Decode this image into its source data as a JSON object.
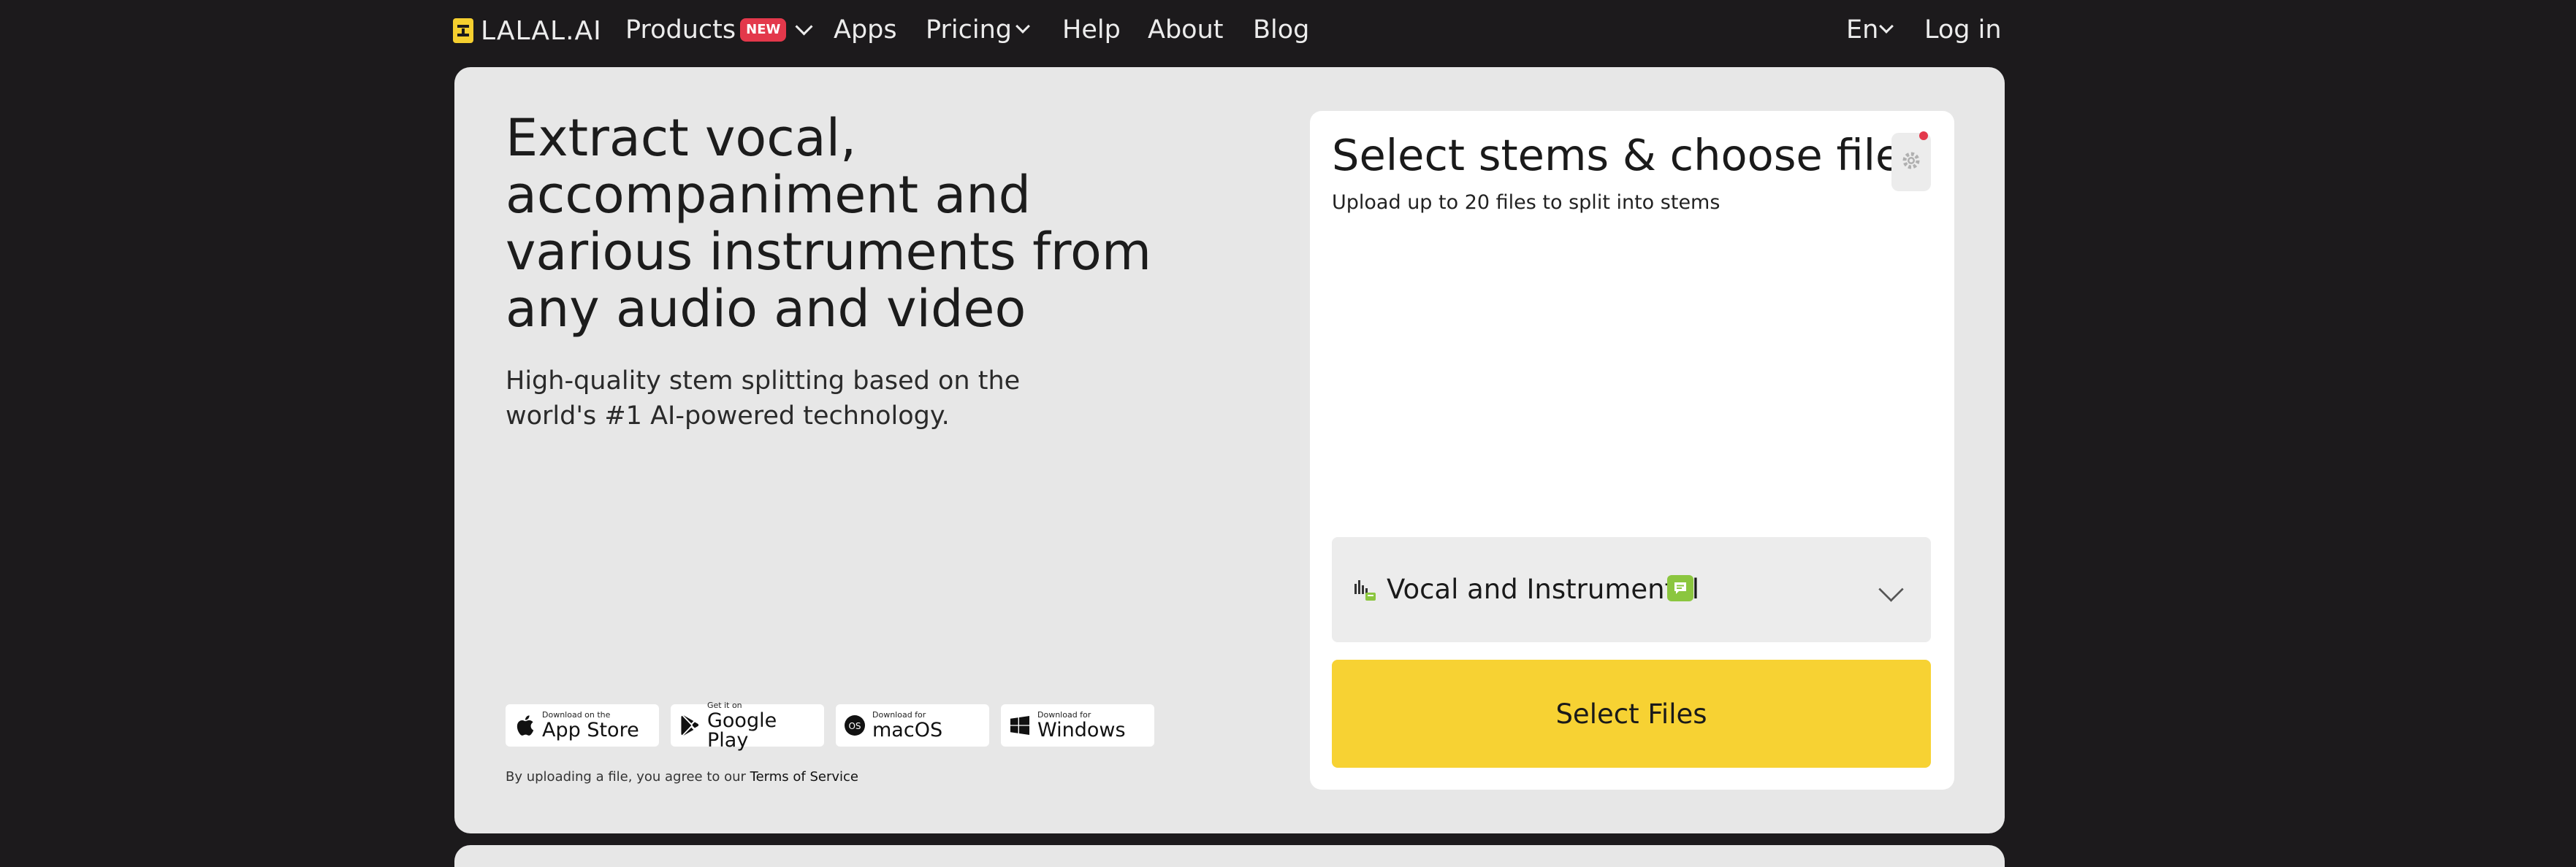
{
  "logo": {
    "text": "LALAL.AI"
  },
  "nav": {
    "products": "Products",
    "products_badge": "NEW",
    "apps": "Apps",
    "pricing": "Pricing",
    "help": "Help",
    "about": "About",
    "blog": "Blog",
    "language": "En",
    "login": "Log in"
  },
  "hero": {
    "headline": "Extract vocal, accompaniment and various instruments from any audio and video",
    "subheadline": "High-quality stem splitting based on the world's #1 AI-powered technology.",
    "stores": [
      {
        "small": "Download on the",
        "big": "App Store",
        "icon": "apple-icon"
      },
      {
        "small": "Get it on",
        "big": "Google Play",
        "icon": "google-play-icon"
      },
      {
        "small": "Download for",
        "big": "macOS",
        "icon": "macos-icon"
      },
      {
        "small": "Download for",
        "big": "Windows",
        "icon": "windows-icon"
      }
    ],
    "legal_prefix": "By uploading a file, you agree to our ",
    "legal_link": "Terms of Service"
  },
  "upload": {
    "title": "Select stems & choose files",
    "subtitle": "Upload up to 20 files to split into stems",
    "stem_selected": "Vocal and Instrumental",
    "select_button": "Select Files"
  },
  "colors": {
    "background": "#1c1a1c",
    "accent_yellow": "#f7d233",
    "badge_red": "#e3384b",
    "stem_green": "#8bc63f"
  }
}
